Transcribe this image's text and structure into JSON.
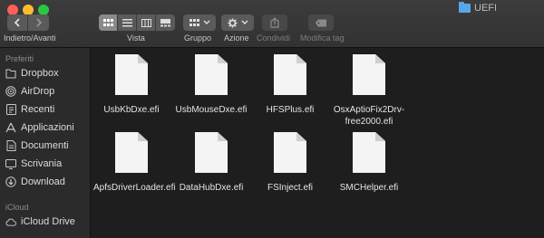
{
  "window": {
    "title": "UEFI"
  },
  "toolbar": {
    "nav_label": "Indietro/Avanti",
    "view_label": "Vista",
    "group_label": "Gruppo",
    "action_label": "Azione",
    "share_label": "Condividi",
    "tag_label": "Modifica tag"
  },
  "sidebar": {
    "favorites_header": "Preferiti",
    "items": [
      {
        "label": "Dropbox",
        "icon": "dropbox-icon"
      },
      {
        "label": "AirDrop",
        "icon": "airdrop-icon"
      },
      {
        "label": "Recenti",
        "icon": "recents-icon"
      },
      {
        "label": "Applicazioni",
        "icon": "applications-icon"
      },
      {
        "label": "Documenti",
        "icon": "documents-icon"
      },
      {
        "label": "Scrivania",
        "icon": "desktop-icon"
      },
      {
        "label": "Download",
        "icon": "download-icon"
      }
    ],
    "icloud_header": "iCloud",
    "icloud_items": [
      {
        "label": "iCloud Drive",
        "icon": "cloud-icon"
      }
    ]
  },
  "files": [
    {
      "name": "UsbKbDxe.efi"
    },
    {
      "name": "UsbMouseDxe.efi"
    },
    {
      "name": "HFSPlus.efi"
    },
    {
      "name": "OsxAptioFix2Drv-free2000.efi"
    },
    {
      "name": "ApfsDriverLoader.efi"
    },
    {
      "name": "DataHubDxe.efi"
    },
    {
      "name": "FSInject.efi"
    },
    {
      "name": "SMCHelper.efi"
    }
  ]
}
